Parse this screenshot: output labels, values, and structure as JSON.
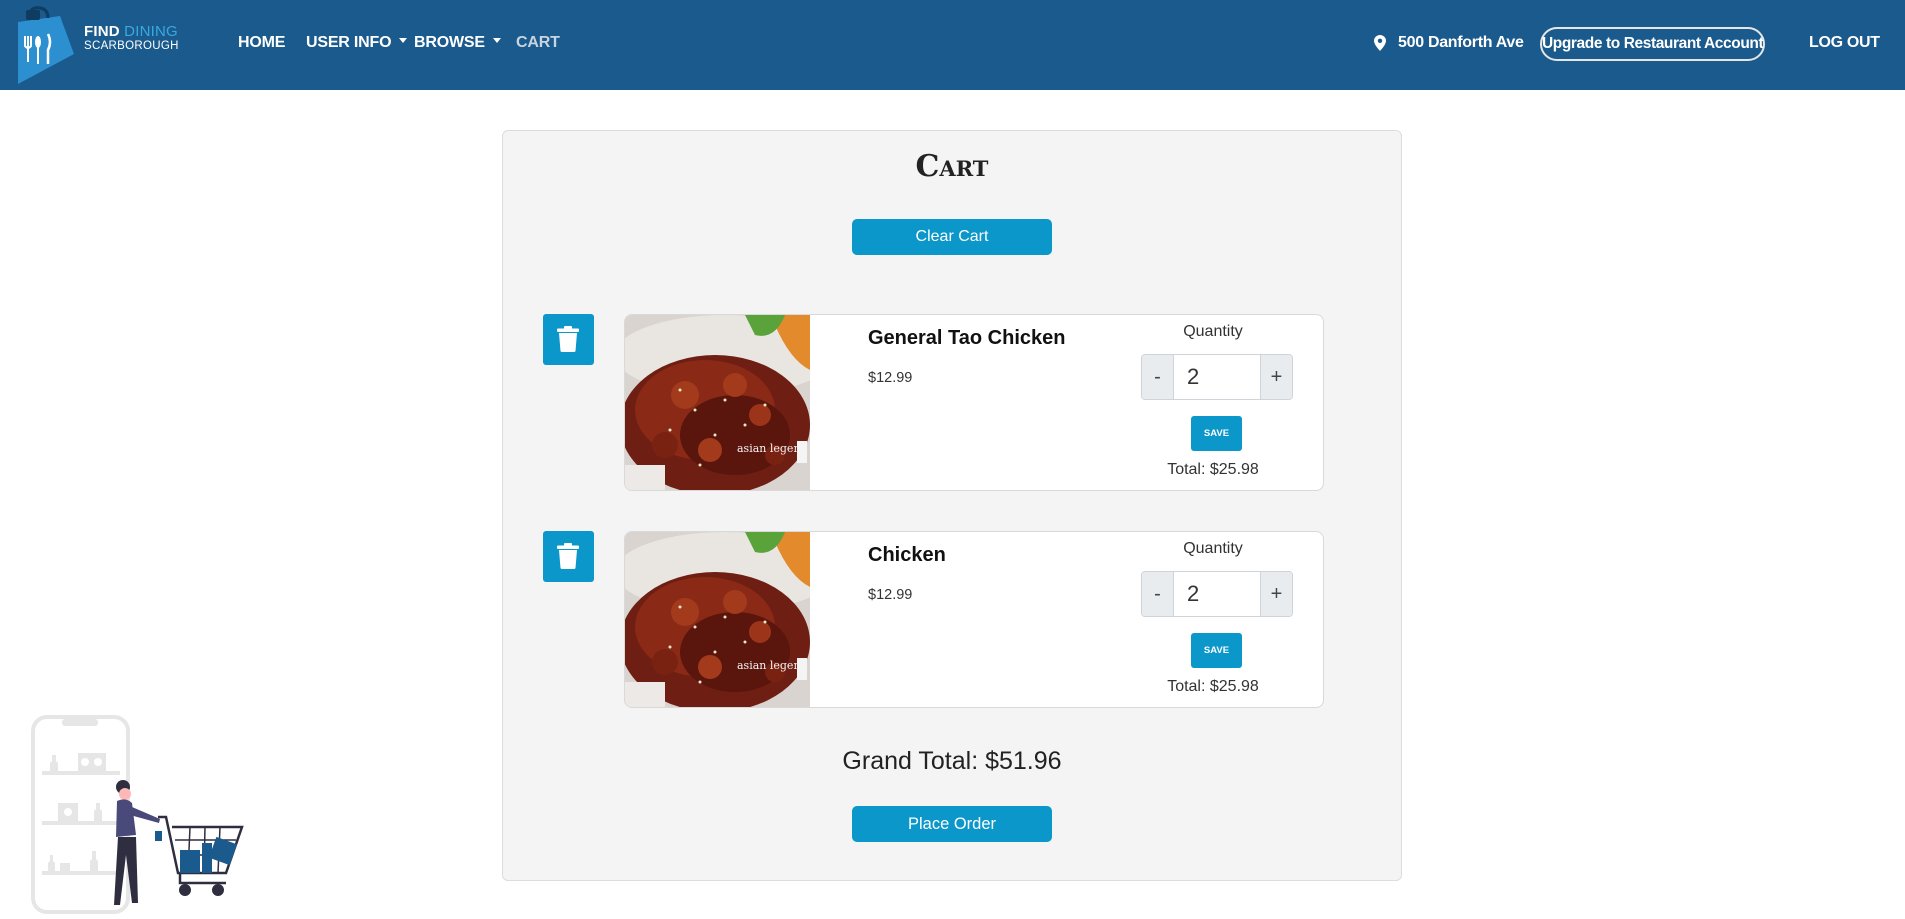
{
  "nav": {
    "logo_line1_a": "FIND",
    "logo_line1_b": "DINING",
    "logo_line2": "SCARBOROUGH",
    "home": "HOME",
    "user_info": "USER INFO",
    "browse": "BROWSE",
    "cart": "CART",
    "address": "500 Danforth Ave",
    "upgrade": "Upgrade to Restaurant Account",
    "logout": "LOG OUT"
  },
  "colors": {
    "navbar": "#1a5a8c",
    "accent_button": "#0b97c9",
    "panel_bg": "#f4f4f4"
  },
  "cart": {
    "title": "Cart",
    "clear_label": "Clear Cart",
    "quantity_label": "Quantity",
    "save_label": "SAVE",
    "minus": "-",
    "plus": "+",
    "items": [
      {
        "name": "General Tao Chicken",
        "price": "$12.99",
        "quantity": "2",
        "total": "Total: $25.98",
        "image_watermark": "asian legend"
      },
      {
        "name": "Chicken",
        "price": "$12.99",
        "quantity": "2",
        "total": "Total: $25.98",
        "image_watermark": "asian legend"
      }
    ],
    "grand_total": "Grand Total: $51.96",
    "place_order_label": "Place Order"
  },
  "icons": {
    "location": "map-pin-icon",
    "trash": "trash-icon"
  }
}
